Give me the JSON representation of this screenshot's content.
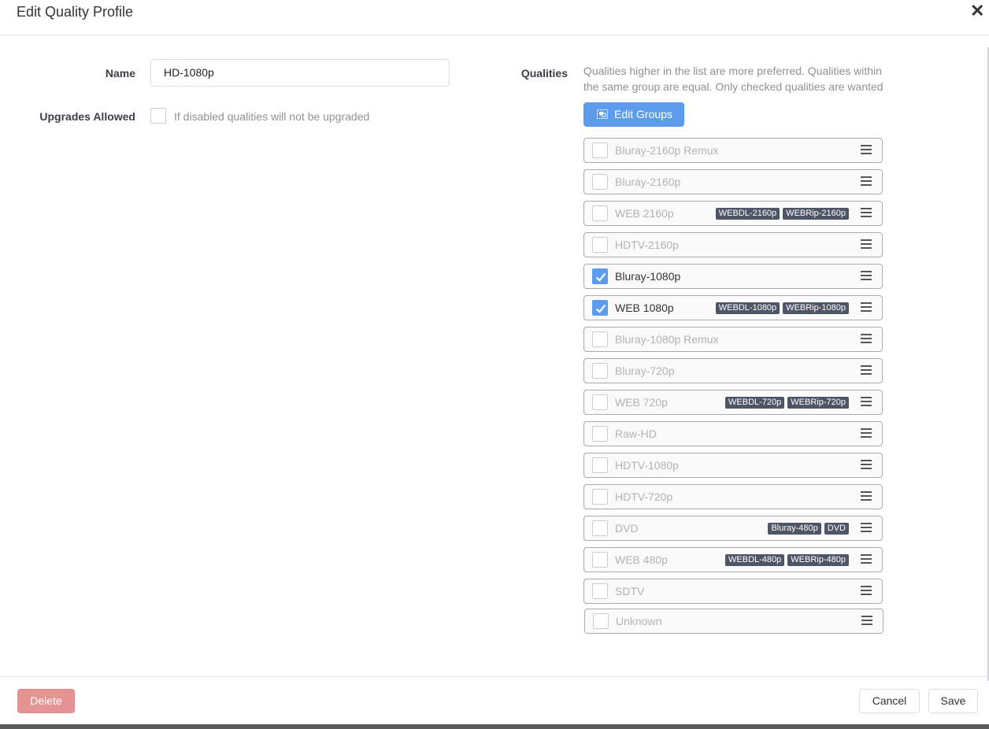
{
  "modal": {
    "title": "Edit Quality Profile"
  },
  "form": {
    "name_label": "Name",
    "name_value": "HD-1080p",
    "upgrades_label": "Upgrades Allowed",
    "upgrades_help": "If disabled qualities will not be upgraded",
    "upgrades_checked": false,
    "qualities_label": "Qualities",
    "qualities_help": "Qualities higher in the list are more preferred. Qualities within the same group are equal. Only checked qualities are wanted",
    "edit_groups_label": "Edit Groups"
  },
  "qualities": [
    {
      "name": "Bluray-2160p Remux",
      "checked": false,
      "tags": []
    },
    {
      "name": "Bluray-2160p",
      "checked": false,
      "tags": []
    },
    {
      "name": "WEB 2160p",
      "checked": false,
      "tags": [
        "WEBDL-2160p",
        "WEBRip-2160p"
      ]
    },
    {
      "name": "HDTV-2160p",
      "checked": false,
      "tags": []
    },
    {
      "name": "Bluray-1080p",
      "checked": true,
      "tags": []
    },
    {
      "name": "WEB 1080p",
      "checked": true,
      "tags": [
        "WEBDL-1080p",
        "WEBRip-1080p"
      ]
    },
    {
      "name": "Bluray-1080p Remux",
      "checked": false,
      "tags": []
    },
    {
      "name": "Bluray-720p",
      "checked": false,
      "tags": []
    },
    {
      "name": "WEB 720p",
      "checked": false,
      "tags": [
        "WEBDL-720p",
        "WEBRip-720p"
      ]
    },
    {
      "name": "Raw-HD",
      "checked": false,
      "tags": []
    },
    {
      "name": "HDTV-1080p",
      "checked": false,
      "tags": []
    },
    {
      "name": "HDTV-720p",
      "checked": false,
      "tags": []
    },
    {
      "name": "DVD",
      "checked": false,
      "tags": [
        "Bluray-480p",
        "DVD"
      ]
    },
    {
      "name": "WEB 480p",
      "checked": false,
      "tags": [
        "WEBDL-480p",
        "WEBRip-480p"
      ]
    },
    {
      "name": "SDTV",
      "checked": false,
      "tags": []
    },
    {
      "name": "Unknown",
      "checked": false,
      "tags": []
    }
  ],
  "footer": {
    "delete_label": "Delete",
    "cancel_label": "Cancel",
    "save_label": "Save"
  },
  "colors": {
    "accent": "#5d9cec",
    "delete": "#e59494",
    "tag_bg": "#4e5566"
  },
  "icons": {
    "close": "close-icon",
    "edit_groups": "object-group-icon",
    "drag": "drag-handle-icon",
    "check": "check-icon"
  }
}
